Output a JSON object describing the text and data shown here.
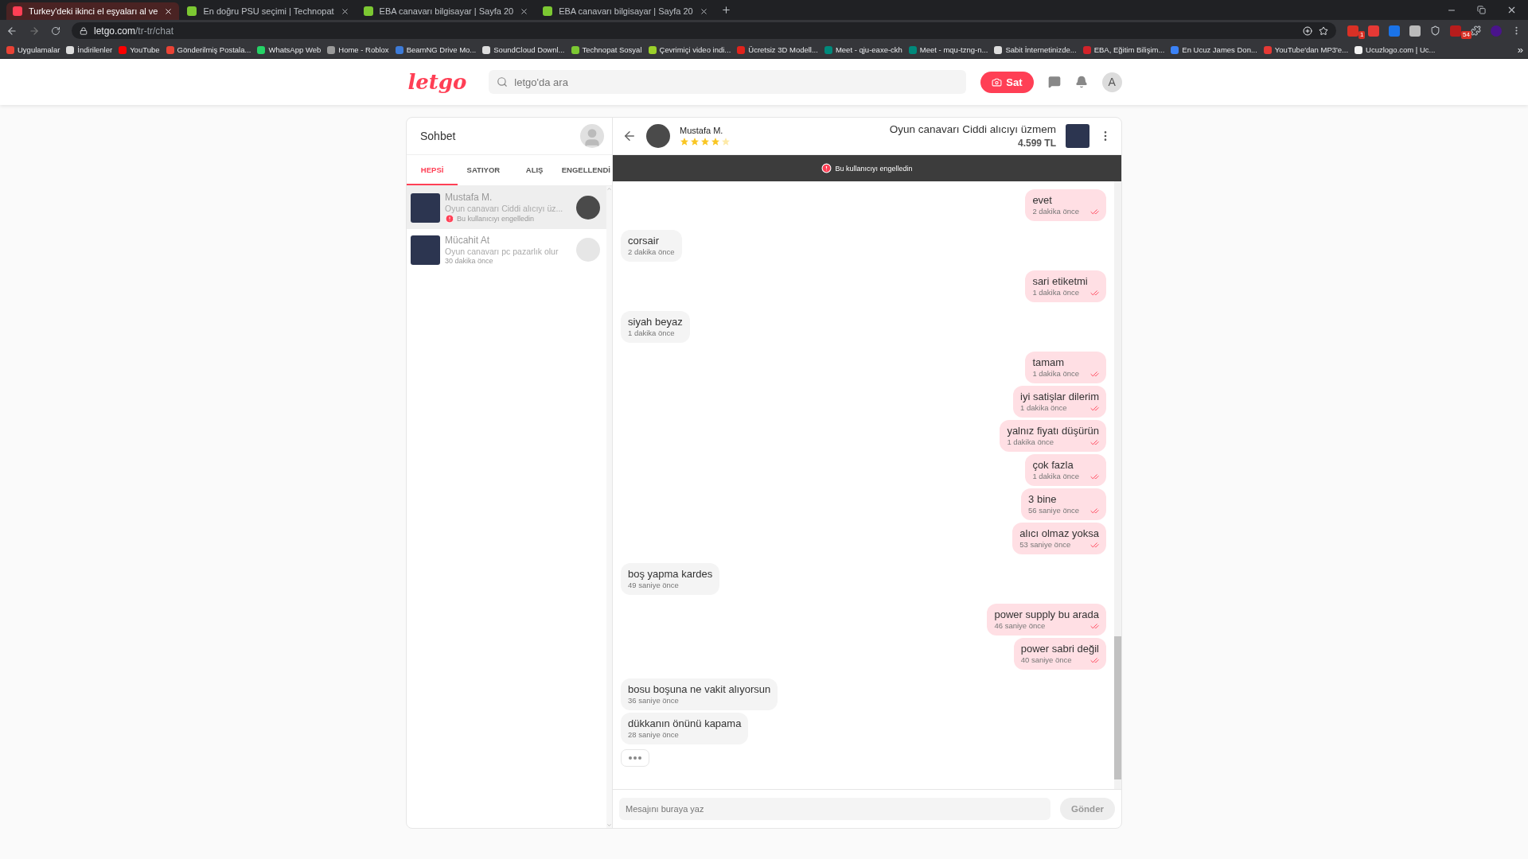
{
  "browser": {
    "tabs": [
      {
        "title": "Turkey'deki ikinci el eşyaları al ve",
        "selected": true,
        "color": "#ff3f55"
      },
      {
        "title": "En doğru PSU seçimi | Technopat",
        "selected": false,
        "color": "#7cc832"
      },
      {
        "title": "EBA canavarı bilgisayar | Sayfa 20",
        "selected": false,
        "color": "#7cc832"
      },
      {
        "title": "EBA canavarı bilgisayar | Sayfa 20",
        "selected": false,
        "color": "#7cc832"
      }
    ],
    "address": {
      "host": "letgo.com",
      "path": "/tr-tr/chat"
    },
    "extension_badges": [
      "1",
      "54"
    ],
    "bookmarks": [
      {
        "label": "Uygulamalar",
        "color": "#e94235"
      },
      {
        "label": "İndirilenler",
        "color": "#dddddd"
      },
      {
        "label": "YouTube",
        "color": "#ff0000"
      },
      {
        "label": "Gönderilmiş Postala...",
        "color": "#ea4335"
      },
      {
        "label": "WhatsApp Web",
        "color": "#25d366"
      },
      {
        "label": "Home - Roblox",
        "color": "#9a9a9a"
      },
      {
        "label": "BeamNG Drive Mo...",
        "color": "#3d7bd8"
      },
      {
        "label": "SoundCloud Downl...",
        "color": "#dddddd"
      },
      {
        "label": "Technopat Sosyal",
        "color": "#7cc832"
      },
      {
        "label": "Çevrimiçi video indi...",
        "color": "#9bd02a"
      },
      {
        "label": "Ücretsiz 3D Modell...",
        "color": "#e0231c"
      },
      {
        "label": "Meet - qju-eaxe-ckh",
        "color": "#00897b"
      },
      {
        "label": "Meet - mqu-tzng-n...",
        "color": "#00897b"
      },
      {
        "label": "Sabit İnternetinizde...",
        "color": "#dddddd"
      },
      {
        "label": "EBA, Eğitim Bilişim...",
        "color": "#d2232a"
      },
      {
        "label": "En Ucuz James Don...",
        "color": "#3b82f6"
      },
      {
        "label": "YouTube'dan MP3'e...",
        "color": "#e53935"
      },
      {
        "label": "Ucuzlogo.com | Uc...",
        "color": "#f2f2f2"
      }
    ],
    "bookmarks_more": "»"
  },
  "header": {
    "logo": "letgo",
    "search": {
      "placeholder": "letgo'da ara"
    },
    "sell_button": "Sat",
    "avatar_initial": "A"
  },
  "sidebar": {
    "title": "Sohbet",
    "tabs": [
      {
        "label": "HEPSİ",
        "selected": true
      },
      {
        "label": "SATIYOR",
        "selected": false
      },
      {
        "label": "ALIŞ",
        "selected": false
      },
      {
        "label": "ENGELLENDİ",
        "selected": false
      }
    ],
    "conversations": [
      {
        "name": "Mustafa M.",
        "preview": "Oyun canavarı Ciddi alıcıyı üz...",
        "note": "Bu kullanıcıyı engelledin",
        "blocked": true,
        "selected": true
      },
      {
        "name": "Mücahit At",
        "preview": "Oyun canavarı pc pazarlık olur",
        "note": "30 dakika önce",
        "blocked": false,
        "selected": false
      }
    ]
  },
  "chat": {
    "user": {
      "name": "Mustafa M.",
      "stars": 4
    },
    "product": {
      "title": "Oyun canavarı Ciddi alıcıyı üzmem",
      "price": "4.599 TL"
    },
    "banner": "Bu kullanıcıyı engelledin",
    "messages": [
      {
        "kind": "sent",
        "text": "evet",
        "time": "2 dakika önce",
        "read": true
      },
      {
        "kind": "received",
        "text": "corsair",
        "time": "2 dakika önce"
      },
      {
        "kind": "sent",
        "text": "sari etiketmi",
        "time": "1 dakika önce",
        "read": true
      },
      {
        "kind": "received",
        "text": "siyah beyaz",
        "time": "1 dakika önce"
      },
      {
        "kind": "sent",
        "text": "tamam",
        "time": "1 dakika önce",
        "read": true
      },
      {
        "kind": "sent",
        "text": "iyi satişlar dilerim",
        "time": "1 dakika önce",
        "read": true
      },
      {
        "kind": "sent",
        "text": "yalnız fiyatı düşürün",
        "time": "1 dakika önce",
        "read": true
      },
      {
        "kind": "sent",
        "text": "çok fazla",
        "time": "1 dakika önce",
        "read": true
      },
      {
        "kind": "sent",
        "text": "3 bine",
        "time": "56 saniye önce",
        "read": true
      },
      {
        "kind": "sent",
        "text": "alıcı olmaz yoksa",
        "time": "53 saniye önce",
        "read": true
      },
      {
        "kind": "received",
        "text": "boş yapma kardes",
        "time": "49 saniye önce"
      },
      {
        "kind": "sent",
        "text": "power supply bu arada",
        "time": "46 saniye önce",
        "read": true
      },
      {
        "kind": "sent",
        "text": "power sabri değil",
        "time": "40 saniye önce",
        "read": true
      },
      {
        "kind": "received",
        "text": "bosu boşuna ne vakit alıyorsun",
        "time": "36 saniye önce"
      },
      {
        "kind": "received",
        "text": "dükkanın önünü kapama",
        "time": "28 saniye önce"
      }
    ],
    "typing": true,
    "composer": {
      "placeholder": "Mesajını buraya yaz",
      "send": "Gönder"
    }
  }
}
